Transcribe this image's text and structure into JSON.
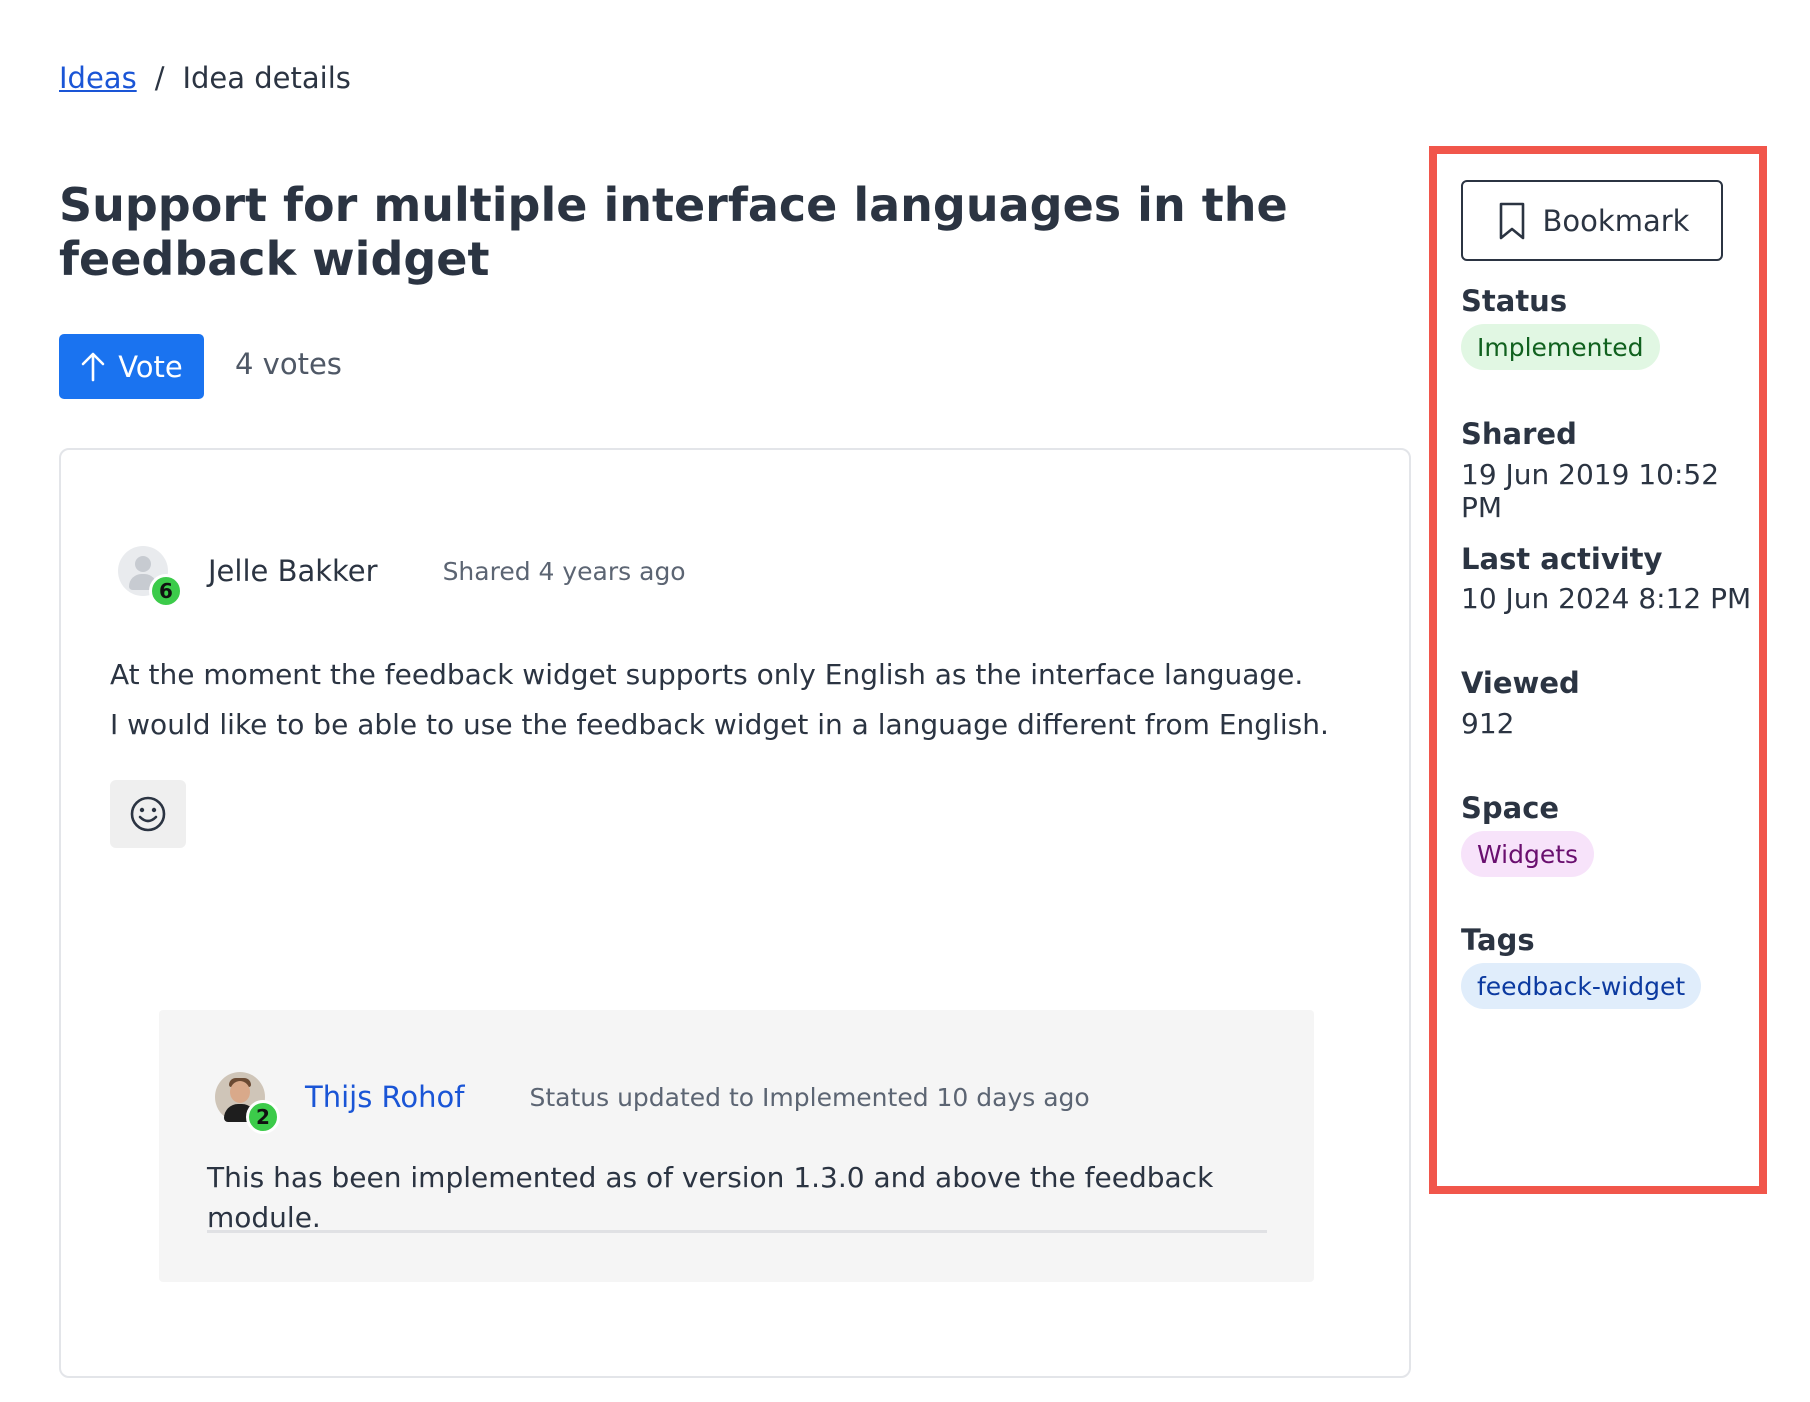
{
  "breadcrumb": {
    "root": "Ideas",
    "separator": "/",
    "current": "Idea details"
  },
  "idea": {
    "title": "Support for multiple interface languages in the feedback widget",
    "vote_label": "Vote",
    "votes": "4 votes",
    "author": {
      "name": "Jelle Bakker",
      "badge": "6",
      "meta": "Shared 4 years ago"
    },
    "body": [
      "At  the moment the feedback widget supports only English as the interface language.",
      "I would like to be able to use the feedback widget in a language different from English."
    ],
    "reaction_icon": "smiley-icon"
  },
  "comment": {
    "author": "Thijs Rohof",
    "badge": "2",
    "meta": "Status updated to Implemented 10 days ago",
    "text": "This has been implemented as of version 1.3.0 and above the feedback module."
  },
  "sidebar": {
    "bookmark_label": "Bookmark",
    "status_label": "Status",
    "status_value": "Implemented",
    "shared_label": "Shared",
    "shared_value": "19 Jun 2019 10:52 PM",
    "last_activity_label": "Last activity",
    "last_activity_value": "10 Jun 2024 8:12 PM",
    "viewed_label": "Viewed",
    "viewed_value": "912",
    "space_label": "Space",
    "space_value": "Widgets",
    "tags_label": "Tags",
    "tags": [
      "feedback-widget"
    ]
  },
  "colors": {
    "primary": "#1a73f0",
    "link": "#1a55d6",
    "highlight_border": "#f1564b",
    "badge_green": "#3ccb4a"
  }
}
